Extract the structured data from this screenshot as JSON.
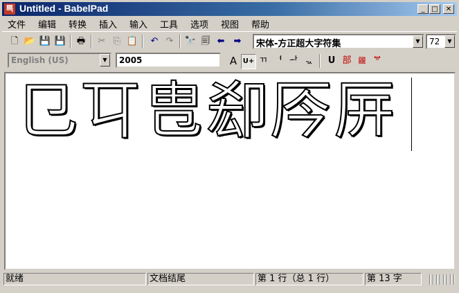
{
  "window": {
    "title": "Untitled - BabelPad",
    "app_icon_glyph": "巪"
  },
  "window_buttons": {
    "minimize": "_",
    "maximize": "□",
    "close": "✕"
  },
  "menu": [
    "文件",
    "编辑",
    "转换",
    "插入",
    "输入",
    "工具",
    "选项",
    "视图",
    "帮助"
  ],
  "toolbar1": {
    "icons": [
      "new-icon",
      "open-icon",
      "save-icon",
      "save-all-icon",
      "print-icon",
      "cut-icon",
      "copy-icon",
      "paste-icon",
      "undo-icon",
      "redo-icon",
      "find-icon",
      "replace-icon",
      "back-icon",
      "forward-icon"
    ],
    "font_name": "宋体-方正超大字符集",
    "font_size": "72"
  },
  "toolbar2": {
    "language": "English (US)",
    "codepoint_value": "2005",
    "buttons": [
      "A",
      "U+",
      "ㄲ",
      "ᅧ",
      "ᅪ",
      "ᆪ",
      "U",
      "部",
      "龖",
      "ᄫ"
    ]
  },
  "editor": {
    "text": "㔾㔿㕀㕁㕂㕃"
  },
  "status": {
    "state": "就绪",
    "position": "文档结尾",
    "line": "第 1 行（总 1 行）",
    "char": "第 13 字"
  },
  "colors": {
    "titlebar_start": "#0a246a",
    "titlebar_end": "#a6caf0",
    "face": "#d4d0c8"
  }
}
